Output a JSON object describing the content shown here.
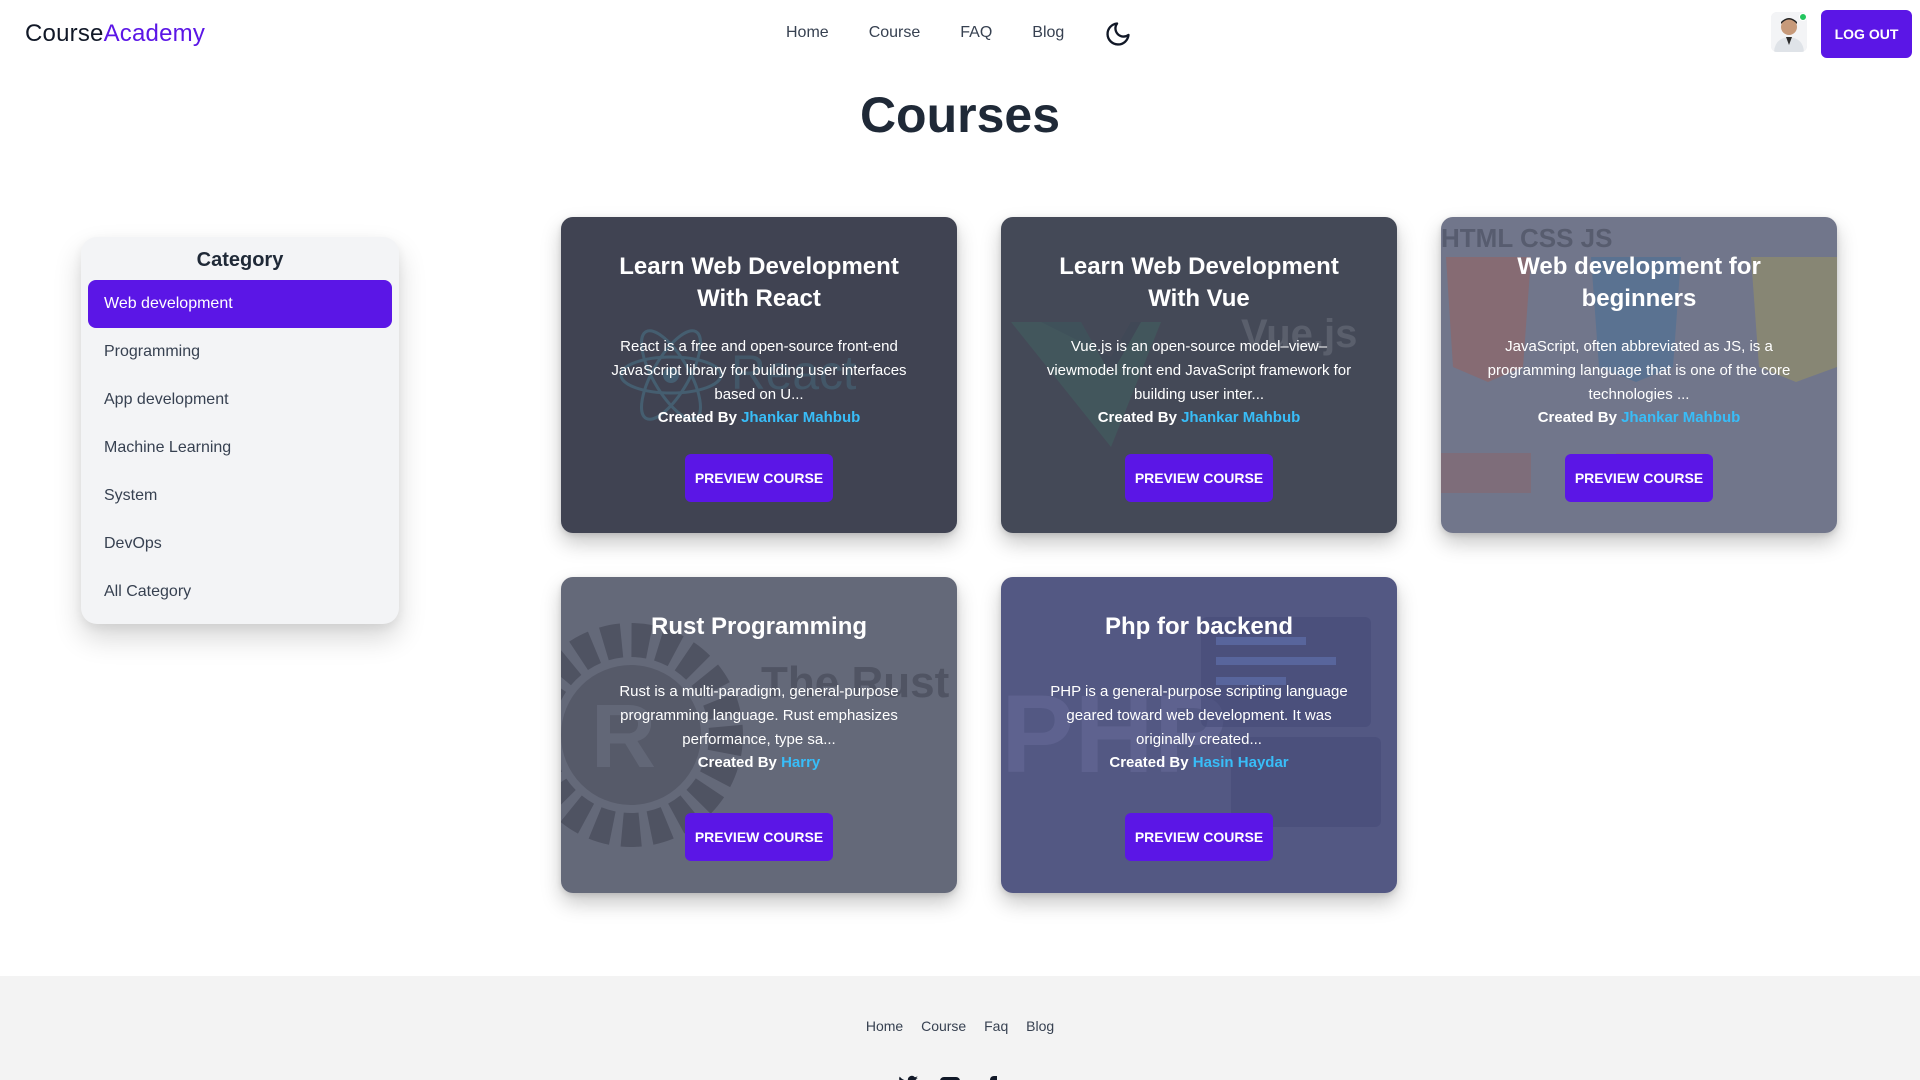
{
  "brand": {
    "part1": "Course",
    "part2": "Academy"
  },
  "nav": {
    "links": [
      "Home",
      "Course",
      "FAQ",
      "Blog"
    ],
    "logout_label": "LOG OUT"
  },
  "page_title": "Courses",
  "sidebar": {
    "title": "Category",
    "items": [
      "Web development",
      "Programming",
      "App development",
      "Machine Learning",
      "System",
      "DevOps",
      "All Category"
    ],
    "active_index": 0
  },
  "cards": [
    {
      "title": "Learn Web Development With React",
      "description": "React is a free and open-source front-end JavaScript library for building user interfaces based on U...",
      "created_by_label": "Created By",
      "author": "Jhankar Mahbub",
      "button_label": "PREVIEW COURSE",
      "bg_text": "React"
    },
    {
      "title": "Learn Web Development With Vue",
      "description": "Vue.js is an open-source model–view–viewmodel front end JavaScript framework for building user inter...",
      "created_by_label": "Created By",
      "author": "Jhankar Mahbub",
      "button_label": "PREVIEW COURSE",
      "bg_text": "Vue.js"
    },
    {
      "title": "Web development for beginners",
      "description": "JavaScript, often abbreviated as JS, is a programming language that is one of the core technologies ...",
      "created_by_label": "Created By",
      "author": "Jhankar Mahbub",
      "button_label": "PREVIEW COURSE",
      "bg_text": "HTML CSS JS"
    },
    {
      "title": "Rust Programming",
      "description": "Rust is a multi-paradigm, general-purpose programming language. Rust emphasizes performance, type sa...",
      "created_by_label": "Created By",
      "author": "Harry",
      "button_label": "PREVIEW COURSE",
      "bg_text": "The Rust Programming Language"
    },
    {
      "title": "Php for backend",
      "description": "PHP is a general-purpose scripting language geared toward web development. It was originally created...",
      "created_by_label": "Created By",
      "author": "Hasin Haydar",
      "button_label": "PREVIEW COURSE",
      "bg_text": "PHP"
    }
  ],
  "footer": {
    "links": [
      "Home",
      "Course",
      "Faq",
      "Blog"
    ]
  },
  "colors": {
    "accent": "#5b16e6",
    "author_link": "#38bdf8",
    "footer_bg": "#f3f3f3"
  }
}
